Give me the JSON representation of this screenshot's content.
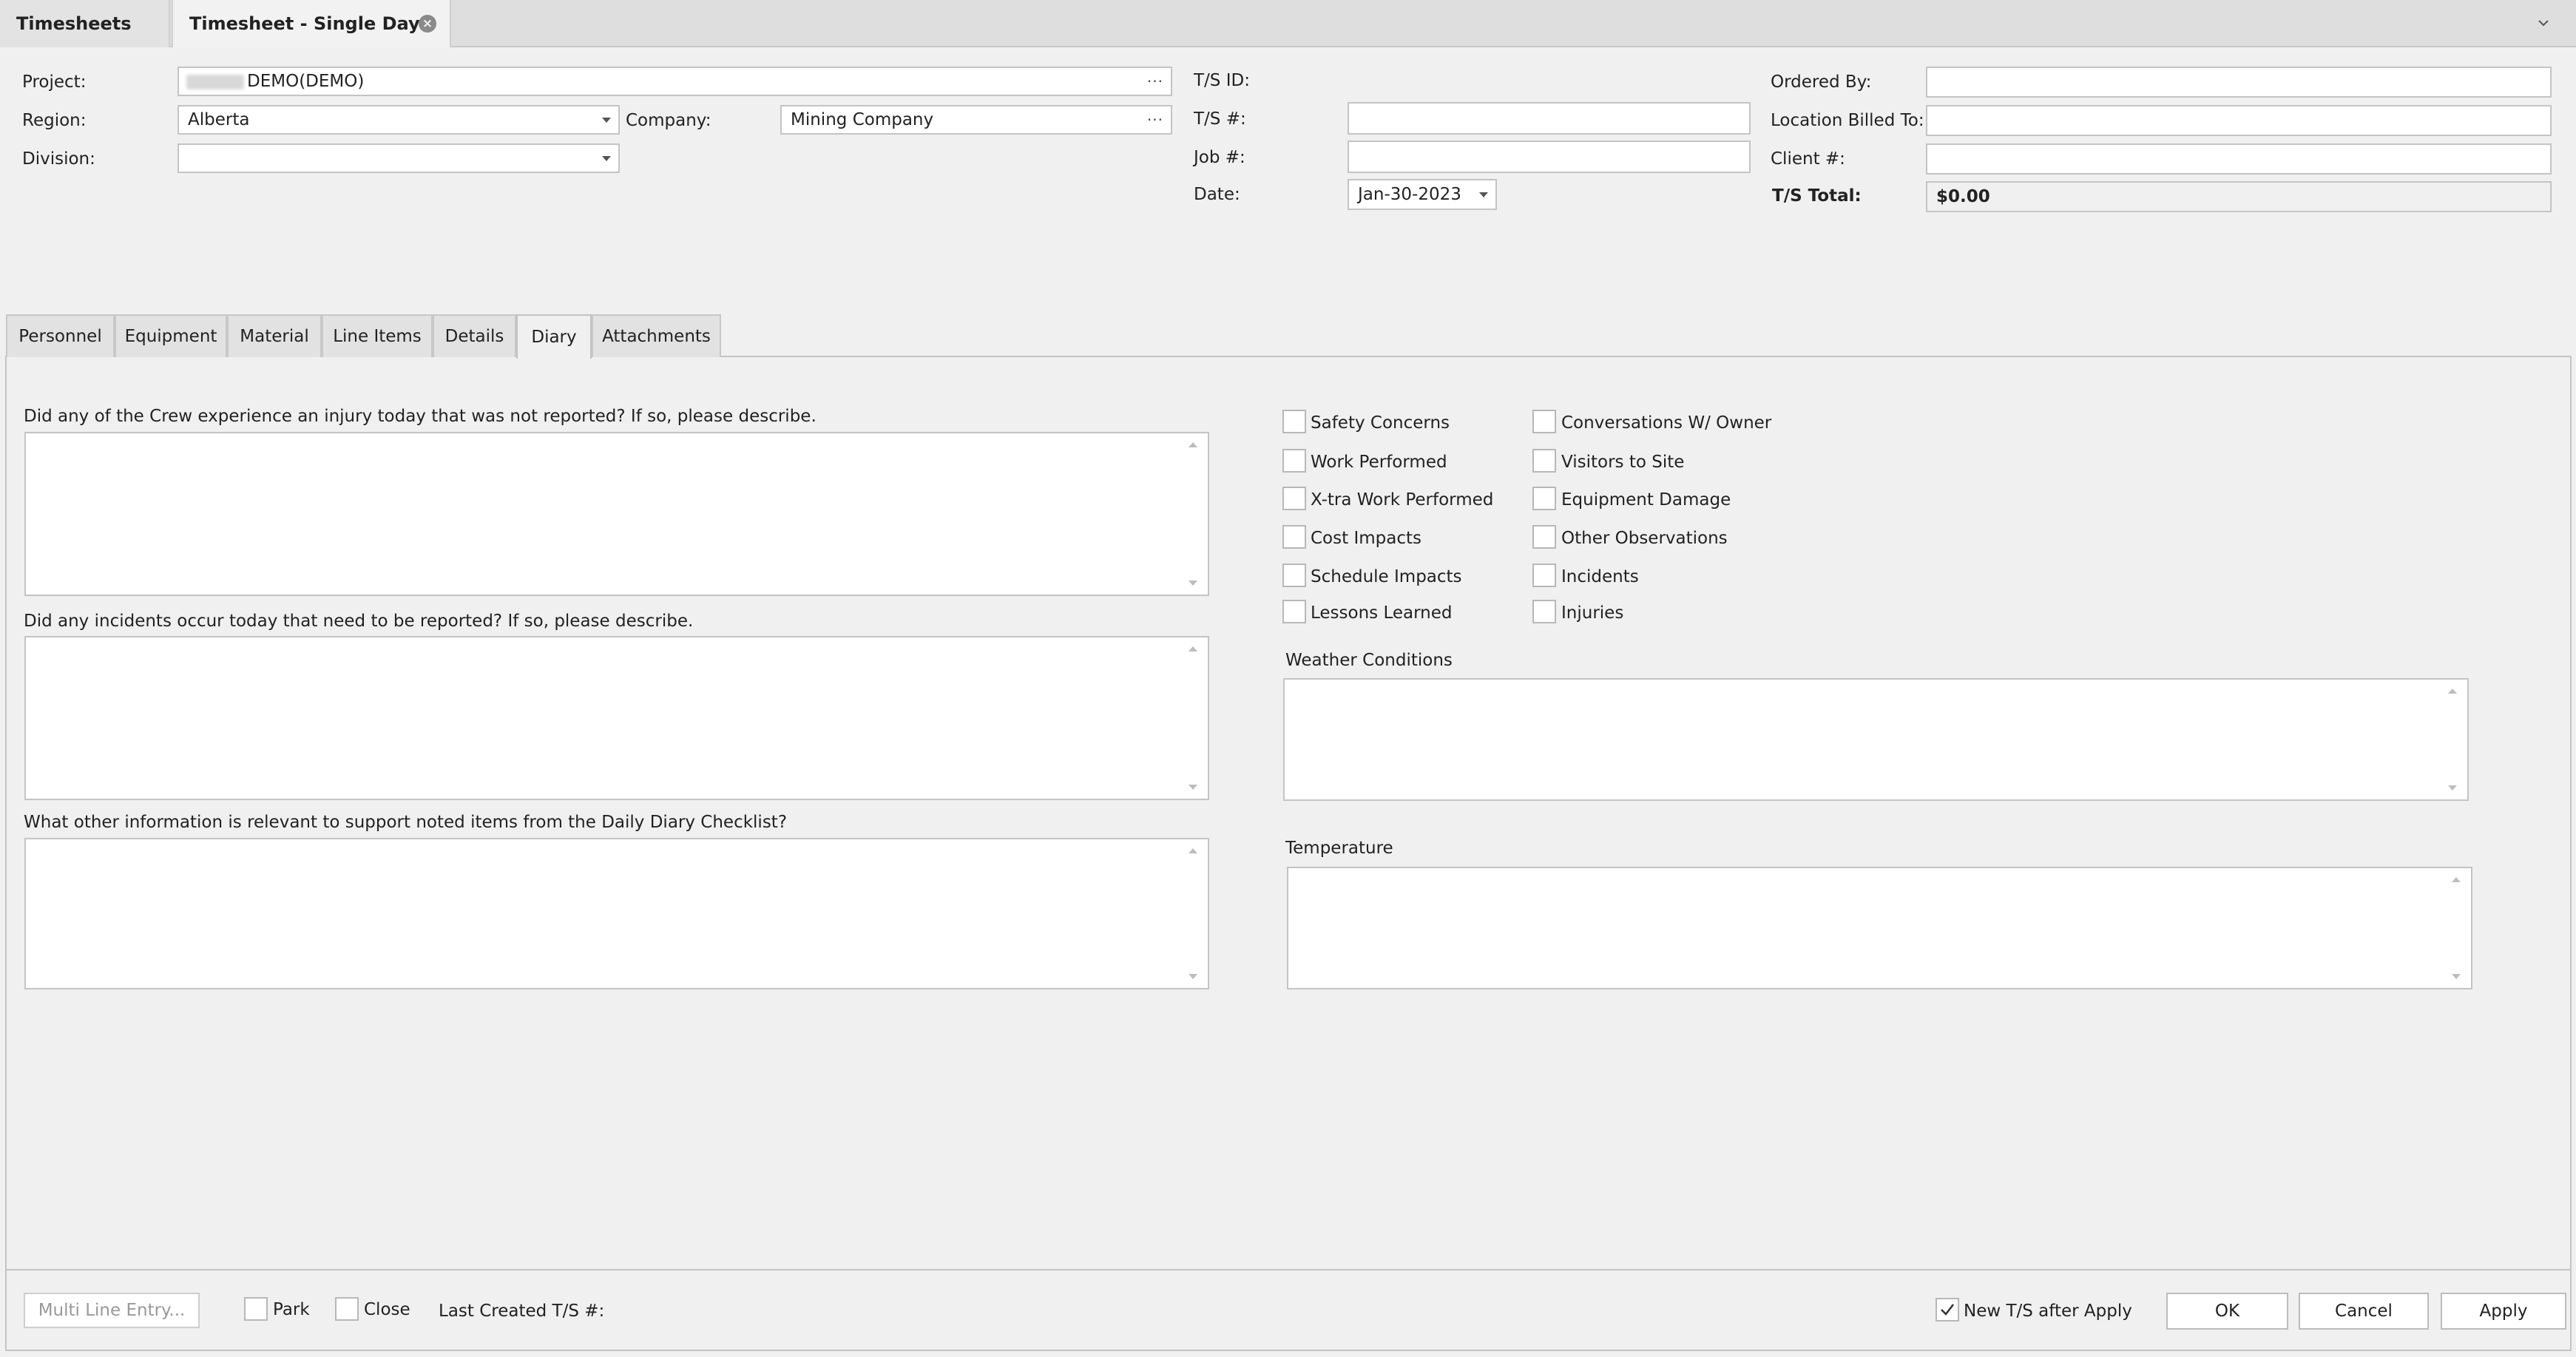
{
  "tabs": {
    "timesheets": "Timesheets",
    "single_day": "Timesheet - Single Day:"
  },
  "header": {
    "project_label": "Project:",
    "project_value": "DEMO(DEMO)",
    "region_label": "Region:",
    "region_value": "Alberta",
    "company_label": "Company:",
    "company_value": "Mining Company",
    "division_label": "Division:",
    "division_value": "",
    "tsid_label": "T/S ID:",
    "tsid_value": "",
    "tsnum_label": "T/S #:",
    "tsnum_value": "",
    "job_label": "Job #:",
    "job_value": "",
    "date_label": "Date:",
    "date_value": "Jan-30-2023",
    "ordered_by_label": "Ordered By:",
    "ordered_by_value": "",
    "location_billed_label": "Location Billed To:",
    "location_billed_value": "",
    "client_label": "Client #:",
    "client_value": "",
    "ts_total_label": "T/S Total:",
    "ts_total_value": "$0.00",
    "ellipsis": "···"
  },
  "panel_tabs": [
    "Personnel",
    "Equipment",
    "Material",
    "Line Items",
    "Details",
    "Diary",
    "Attachments"
  ],
  "active_panel_tab": "Diary",
  "diary": {
    "q1": "Did any of the Crew experience an injury today that was not reported? If so, please describe.",
    "q2": "Did any incidents occur today that need to be reported? If so, please describe.",
    "q3": "What other information is relevant to support noted items from the Daily Diary Checklist?",
    "weather_label": "Weather Conditions",
    "temperature_label": "Temperature",
    "checklist_left": [
      "Safety Concerns",
      "Work Performed",
      "X-tra Work Performed",
      "Cost Impacts",
      "Schedule Impacts",
      "Lessons Learned"
    ],
    "checklist_right": [
      "Conversations W/ Owner",
      "Visitors to Site",
      "Equipment Damage",
      "Other Observations",
      "Incidents",
      "Injuries"
    ]
  },
  "footer": {
    "multi_line_entry": "Multi Line Entry...",
    "park": "Park",
    "close": "Close",
    "last_created_label": "Last Created T/S #:",
    "new_ts_after_apply": "New T/S after Apply",
    "new_ts_checked": true,
    "ok": "OK",
    "cancel": "Cancel",
    "apply": "Apply"
  }
}
